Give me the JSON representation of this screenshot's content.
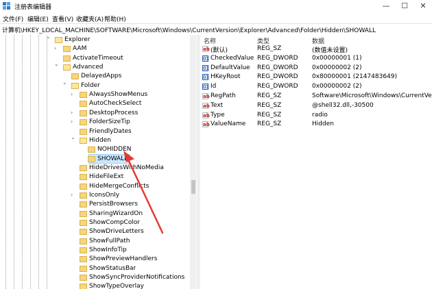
{
  "window": {
    "title": "注册表编辑器",
    "controls": {
      "minimize": "—",
      "maximize": "☐",
      "close": "✕"
    }
  },
  "menu": [
    {
      "label": "文件(F)"
    },
    {
      "label": "编辑(E)"
    },
    {
      "label": "查看(V)"
    },
    {
      "label": "收藏夹(A)"
    },
    {
      "label": "帮助(H)"
    }
  ],
  "address": "计算机\\HKEY_LOCAL_MACHINE\\SOFTWARE\\Microsoft\\Windows\\CurrentVersion\\Explorer\\Advanced\\Folder\\Hidden\\SHOWALL",
  "tree": [
    {
      "label": "Explorer",
      "chev": "⌄",
      "indent": 0,
      "open": true
    },
    {
      "label": "AAM",
      "chev": "›",
      "indent": 1
    },
    {
      "label": "ActivateTimeout",
      "chev": "",
      "indent": 1
    },
    {
      "label": "Advanced",
      "chev": "⌄",
      "indent": 1,
      "open": true
    },
    {
      "label": "DelayedApps",
      "chev": "",
      "indent": 2
    },
    {
      "label": "Folder",
      "chev": "⌄",
      "indent": 2,
      "open": true
    },
    {
      "label": "AlwaysShowMenus",
      "chev": "›",
      "indent": 3
    },
    {
      "label": "AutoCheckSelect",
      "chev": "",
      "indent": 3
    },
    {
      "label": "DesktopProcess",
      "chev": "›",
      "indent": 3
    },
    {
      "label": "FolderSizeTip",
      "chev": "›",
      "indent": 3
    },
    {
      "label": "FriendlyDates",
      "chev": "",
      "indent": 3
    },
    {
      "label": "Hidden",
      "chev": "⌄",
      "indent": 3,
      "open": true
    },
    {
      "label": "NOHIDDEN",
      "chev": "",
      "indent": 4
    },
    {
      "label": "SHOWALL",
      "chev": "",
      "indent": 4,
      "selected": true
    },
    {
      "label": "HideDrivesWithNoMedia",
      "chev": "",
      "indent": 3
    },
    {
      "label": "HideFileExt",
      "chev": "",
      "indent": 3
    },
    {
      "label": "HideMergeConflicts",
      "chev": "",
      "indent": 3
    },
    {
      "label": "IconsOnly",
      "chev": "›",
      "indent": 3
    },
    {
      "label": "PersistBrowsers",
      "chev": "",
      "indent": 3
    },
    {
      "label": "SharingWizardOn",
      "chev": "",
      "indent": 3
    },
    {
      "label": "ShowCompColor",
      "chev": "",
      "indent": 3
    },
    {
      "label": "ShowDriveLetters",
      "chev": "",
      "indent": 3
    },
    {
      "label": "ShowFullPath",
      "chev": "",
      "indent": 3
    },
    {
      "label": "ShowInfoTip",
      "chev": "",
      "indent": 3
    },
    {
      "label": "ShowPreviewHandlers",
      "chev": "",
      "indent": 3
    },
    {
      "label": "ShowStatusBar",
      "chev": "",
      "indent": 3
    },
    {
      "label": "ShowSyncProviderNotifications",
      "chev": "",
      "indent": 3
    },
    {
      "label": "ShowTypeOverlay",
      "chev": "",
      "indent": 3
    }
  ],
  "list": {
    "headers": {
      "name": "名称",
      "type": "类型",
      "data": "数据"
    },
    "rows": [
      {
        "icon": "string-value-icon",
        "name": "(默认)",
        "type": "REG_SZ",
        "data": "(数值未设置)"
      },
      {
        "icon": "dword-value-icon",
        "name": "CheckedValue",
        "type": "REG_DWORD",
        "data": "0x00000001 (1)"
      },
      {
        "icon": "dword-value-icon",
        "name": "DefaultValue",
        "type": "REG_DWORD",
        "data": "0x00000002 (2)"
      },
      {
        "icon": "dword-value-icon",
        "name": "HKeyRoot",
        "type": "REG_DWORD",
        "data": "0x80000001 (2147483649)"
      },
      {
        "icon": "dword-value-icon",
        "name": "Id",
        "type": "REG_DWORD",
        "data": "0x00000002 (2)"
      },
      {
        "icon": "string-value-icon",
        "name": "RegPath",
        "type": "REG_SZ",
        "data": "Software\\Microsoft\\Windows\\CurrentVersion"
      },
      {
        "icon": "string-value-icon",
        "name": "Text",
        "type": "REG_SZ",
        "data": "@shell32.dll,-30500"
      },
      {
        "icon": "string-value-icon",
        "name": "Type",
        "type": "REG_SZ",
        "data": "radio"
      },
      {
        "icon": "string-value-icon",
        "name": "ValueName",
        "type": "REG_SZ",
        "data": "Hidden"
      }
    ]
  },
  "colors": {
    "selection": "#cce8ff",
    "folder": "#f7d57a",
    "annotation_arrow": "#e53935"
  }
}
